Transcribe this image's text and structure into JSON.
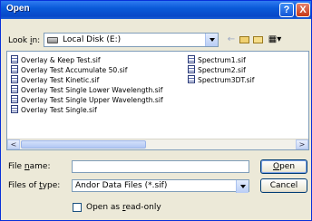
{
  "dialog": {
    "title": "Open",
    "help_label": "?",
    "close_label": "X"
  },
  "lookin": {
    "label": "Look in:",
    "label_prefix": "Look ",
    "label_key": "i",
    "label_suffix": "n:",
    "value": "Local Disk (E:)"
  },
  "toolbar": {
    "back_icon": "back-arrow-icon",
    "up_icon": "up-folder-icon",
    "newfolder_icon": "new-folder-icon",
    "views_icon": "views-menu-icon"
  },
  "files": {
    "column1": [
      "Overlay & Keep Test.sif",
      "Overlay Test Accumulate 50.sif",
      "Overlay Test Kinetic.sif",
      "Overlay Test Single Lower Wavelength.sif",
      "Overlay Test Single Upper Wavelength.sif",
      "Overlay Test Single.sif"
    ],
    "column2": [
      "Spectrum1.sif",
      "Spectrum2.sif",
      "Spectrum3DT.sif"
    ]
  },
  "scroll": {
    "left_glyph": "<",
    "right_glyph": ">"
  },
  "filename": {
    "label_prefix": "File ",
    "label_key": "n",
    "label_suffix": "ame:",
    "value": ""
  },
  "filetype": {
    "label_prefix": "Files of ",
    "label_key": "t",
    "label_suffix": "ype:",
    "value": "Andor Data Files  (*.sif)"
  },
  "buttons": {
    "open_key": "O",
    "open_rest": "pen",
    "cancel": "Cancel"
  },
  "readonly": {
    "label_prefix": "Open as ",
    "label_key": "r",
    "label_suffix": "ead-only",
    "checked": false
  }
}
